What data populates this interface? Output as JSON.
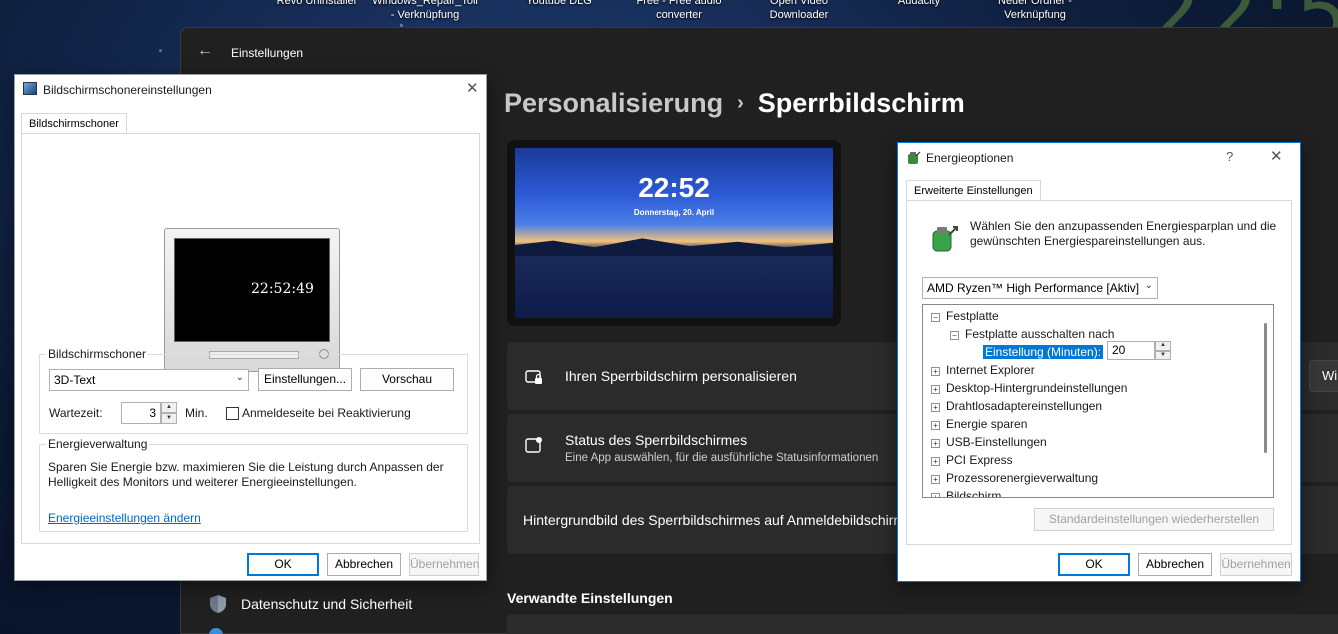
{
  "desktop": {
    "icons": [
      {
        "label": "Revo Uninstaller"
      },
      {
        "label": "Windows_Repair_Toll - Verknüpfung"
      },
      {
        "label": "Youtube DLG"
      },
      {
        "label": "Free - Free audio converter"
      },
      {
        "label": "Open Video Downloader"
      },
      {
        "label": "Audacity"
      },
      {
        "label": "Neuer Ordner - Verknüpfung"
      }
    ],
    "clock": "22:5"
  },
  "settings": {
    "title": "Einstellungen",
    "breadcrumb": {
      "parent": "Personalisierung",
      "separator": "›",
      "current": "Sperrbildschirm"
    },
    "preview": {
      "time": "22:52",
      "date": "Donnerstag, 20. April"
    },
    "cards": [
      {
        "title": "Ihren Sperrbildschirm personalisieren",
        "button": "Wi"
      },
      {
        "title": "Status des Sperrbildschirmes",
        "subtitle": "Eine App auswählen, für die ausführliche Statusinformationen"
      },
      {
        "title": "Hintergrundbild des Sperrbildschirmes auf Anmeldebildschirm"
      }
    ],
    "related_heading": "Verwandte Einstellungen",
    "nav": {
      "privacy": "Datenschutz und Sicherheit"
    }
  },
  "screensaver_dialog": {
    "title": "Bildschirmschonereinstellungen",
    "close": "✕",
    "tab": "Bildschirmschoner",
    "preview_time": "22:52:49",
    "group_screensaver": {
      "label": "Bildschirmschoner",
      "selected": "3D-Text",
      "settings_button": "Einstellungen...",
      "preview_button": "Vorschau",
      "wait_label": "Wartezeit:",
      "wait_value": "3",
      "wait_unit": "Min.",
      "resume_label": "Anmeldeseite bei Reaktivierung",
      "resume_checked": false
    },
    "group_power": {
      "label": "Energieverwaltung",
      "description": "Sparen Sie Energie bzw. maximieren Sie die Leistung durch Anpassen der Helligkeit des Monitors und weiterer Energieeinstellungen.",
      "link": "Energieeinstellungen ändern"
    },
    "buttons": {
      "ok": "OK",
      "cancel": "Abbrechen",
      "apply": "Übernehmen"
    }
  },
  "energy_dialog": {
    "title": "Energieoptionen",
    "help": "?",
    "close": "✕",
    "tab": "Erweiterte Einstellungen",
    "description": "Wählen Sie den anzupassenden Energiesparplan und die gewünschten Energiespareinstellungen aus.",
    "plan": "AMD Ryzen™ High Performance [Aktiv]",
    "tree": {
      "festplatte": "Festplatte",
      "festplatte_aus": "Festplatte ausschalten nach",
      "setting_label": "Einstellung (Minuten):",
      "setting_value": "20",
      "items": [
        "Internet Explorer",
        "Desktop-Hintergrundeinstellungen",
        "Drahtlosadaptereinstellungen",
        "Energie sparen",
        "USB-Einstellungen",
        "PCI Express",
        "Prozessorenergieverwaltung",
        "Bildschirm"
      ]
    },
    "restore_button": "Standardeinstellungen wiederherstellen",
    "buttons": {
      "ok": "OK",
      "cancel": "Abbrechen",
      "apply": "Übernehmen"
    }
  }
}
